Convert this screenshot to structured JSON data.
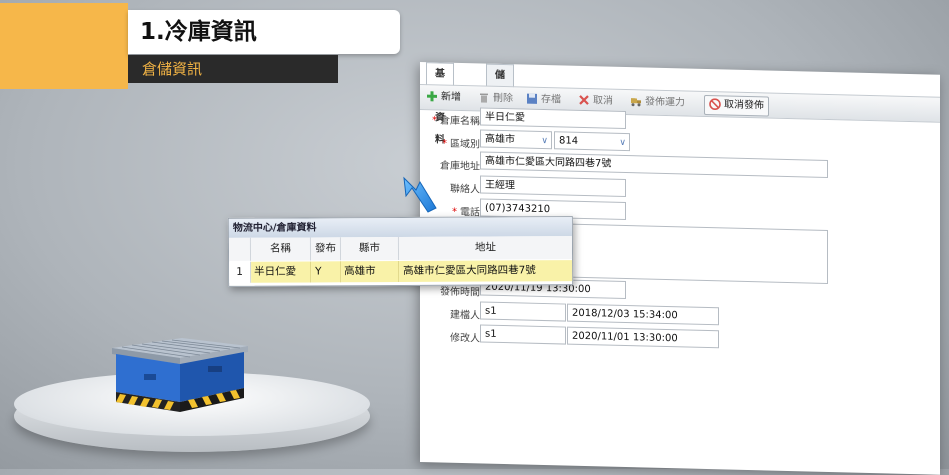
{
  "banner": {
    "title": "1.冷庫資訊",
    "subtitle": "倉儲資訊"
  },
  "tabs": [
    {
      "label": "基本資料",
      "active": true
    },
    {
      "label": "儲位資料",
      "active": false
    }
  ],
  "toolbar": {
    "add": "新增",
    "delete": "刪除",
    "save": "存檔",
    "cancel": "取消",
    "publish_capacity": "發佈運力",
    "cancel_publish": "取消發佈"
  },
  "form": {
    "warehouse_name": {
      "label": "倉庫名稱",
      "value": "半日仁愛",
      "required": true
    },
    "region": {
      "label": "區域別",
      "city": "高雄市",
      "zip": "814",
      "required": true
    },
    "address": {
      "label": "倉庫地址",
      "value": "高雄市仁愛區大同路四巷7號"
    },
    "contact": {
      "label": "聯絡人",
      "value": "王經理"
    },
    "phone": {
      "label": "電話",
      "value": "(07)3743210",
      "required": true
    },
    "publish_time": {
      "label": "發佈時間",
      "value": "2020/11/19 13:30:00"
    },
    "created_by": {
      "label": "建檔人",
      "user": "s1",
      "time": "2018/12/03 15:34:00"
    },
    "modified_by": {
      "label": "修改人",
      "user": "s1",
      "time": "2020/11/01 13:30:00"
    }
  },
  "grid": {
    "title": "物流中心/倉庫資料",
    "columns": [
      "名稱",
      "發布",
      "縣市",
      "地址"
    ],
    "rows": [
      {
        "index": "1",
        "name": "半日仁愛",
        "published": "Y",
        "city": "高雄市",
        "address": "高雄市仁愛區大同路四巷7號"
      }
    ]
  },
  "colors": {
    "accent_orange": "#f6b74a",
    "row_highlight": "#f9f2a8",
    "required_star": "#dd0000"
  }
}
